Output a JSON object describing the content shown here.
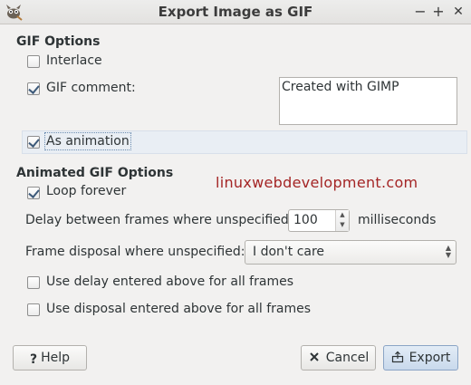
{
  "window": {
    "title": "Export Image as GIF",
    "controls": {
      "minimize": "−",
      "maximize": "+",
      "close": "✕"
    }
  },
  "gif_options": {
    "heading": "GIF Options",
    "interlace": {
      "label": "Interlace",
      "checked": false
    },
    "gif_comment": {
      "label": "GIF comment:",
      "checked": true,
      "value": "Created with GIMP"
    },
    "as_animation": {
      "label": "As animation",
      "checked": true
    }
  },
  "animated_options": {
    "heading": "Animated GIF Options",
    "loop_forever": {
      "label": "Loop forever",
      "checked": true
    },
    "delay": {
      "label": "Delay between frames where unspecified:",
      "value": "100",
      "unit": "milliseconds"
    },
    "disposal": {
      "label": "Frame disposal where unspecified:",
      "value": "I don't care"
    },
    "use_delay_all": {
      "label": "Use delay entered above for all frames",
      "checked": false
    },
    "use_disposal_all": {
      "label": "Use disposal entered above for all frames",
      "checked": false
    }
  },
  "watermark": "linuxwebdevelopment.com",
  "buttons": {
    "help": "Help",
    "cancel": "Cancel",
    "export": "Export"
  },
  "icons": {
    "app": "gimp-icon",
    "help": "question-icon",
    "cancel": "x-icon",
    "export": "export-icon"
  },
  "colors": {
    "watermark": "#a42525",
    "export_button": "#c9d9ec",
    "highlight_row": "#e9eef4"
  }
}
